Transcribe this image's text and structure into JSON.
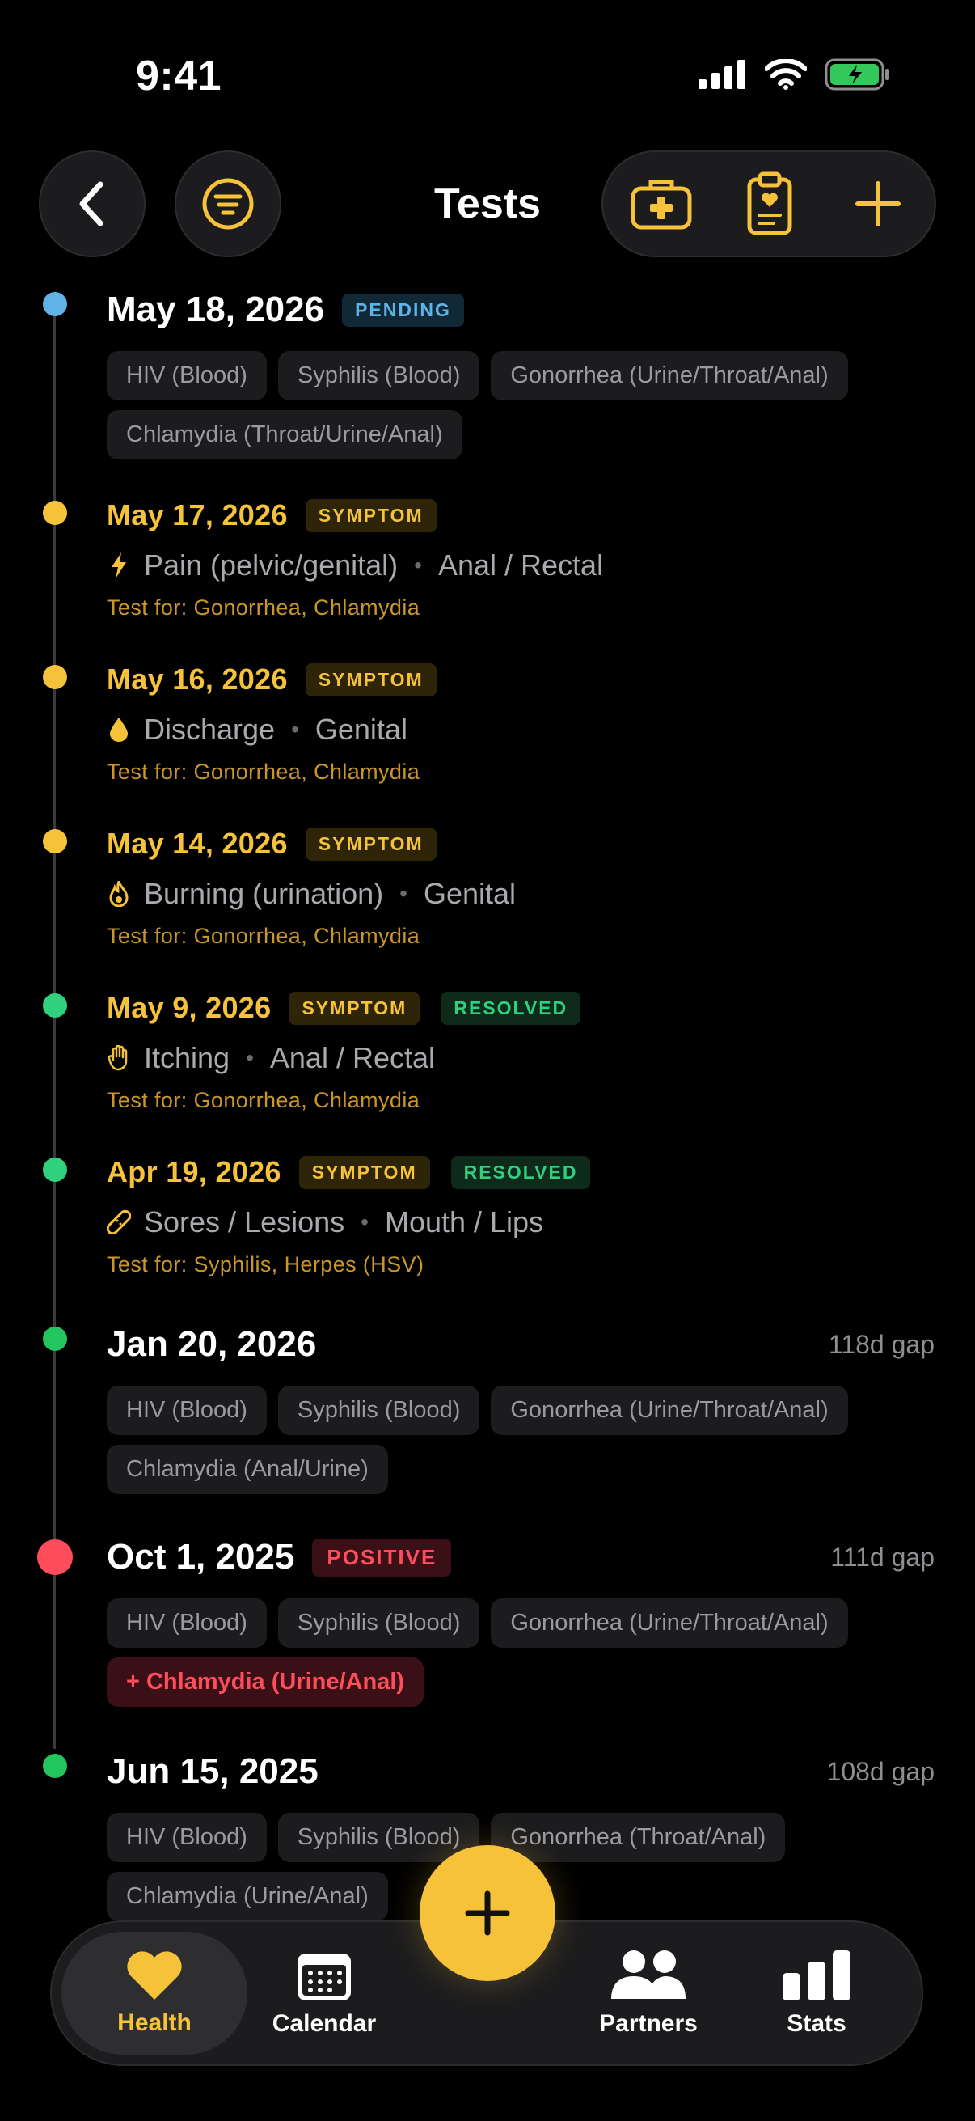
{
  "status": {
    "time": "9:41"
  },
  "header": {
    "title": "Tests"
  },
  "entries": [
    {
      "date": "May 18, 2026",
      "badge": "PENDING",
      "chips": [
        "HIV (Blood)",
        "Syphilis (Blood)",
        "Gonorrhea (Urine/Throat/Anal)",
        "Chlamydia (Throat/Urine/Anal)"
      ]
    },
    {
      "date": "May 17, 2026",
      "badge": "SYMPTOM",
      "symptom": "Pain (pelvic/genital)",
      "site": "Anal / Rectal",
      "test_for": "Test for: Gonorrhea, Chlamydia"
    },
    {
      "date": "May 16, 2026",
      "badge": "SYMPTOM",
      "symptom": "Discharge",
      "site": "Genital",
      "test_for": "Test for: Gonorrhea, Chlamydia"
    },
    {
      "date": "May 14, 2026",
      "badge": "SYMPTOM",
      "symptom": "Burning (urination)",
      "site": "Genital",
      "test_for": "Test for: Gonorrhea, Chlamydia"
    },
    {
      "date": "May 9, 2026",
      "badge": "SYMPTOM",
      "badge2": "RESOLVED",
      "symptom": "Itching",
      "site": "Anal / Rectal",
      "test_for": "Test for: Gonorrhea, Chlamydia"
    },
    {
      "date": "Apr 19, 2026",
      "badge": "SYMPTOM",
      "badge2": "RESOLVED",
      "symptom": "Sores / Lesions",
      "site": "Mouth / Lips",
      "test_for": "Test for: Syphilis, Herpes (HSV)"
    },
    {
      "date": "Jan 20, 2026",
      "gap": "118d gap",
      "chips": [
        "HIV (Blood)",
        "Syphilis (Blood)",
        "Gonorrhea (Urine/Throat/Anal)",
        "Chlamydia (Anal/Urine)"
      ]
    },
    {
      "date": "Oct 1, 2025",
      "badge": "POSITIVE",
      "gap": "111d gap",
      "chips": [
        "HIV (Blood)",
        "Syphilis (Blood)",
        "Gonorrhea (Urine/Throat/Anal)"
      ],
      "positive_chip": "+ Chlamydia (Urine/Anal)"
    },
    {
      "date": "Jun 15, 2025",
      "gap": "108d gap",
      "chips": [
        "HIV (Blood)",
        "Syphilis (Blood)",
        "Gonorrhea (Throat/Anal)",
        "Chlamydia (Urine/Anal)"
      ]
    }
  ],
  "nav": {
    "health": "Health",
    "calendar": "Calendar",
    "partners": "Partners",
    "stats": "Stats"
  },
  "colors": {
    "accent": "#f5c23a",
    "pending": "#5fb3e8",
    "resolved": "#2fd07e",
    "positive": "#ff4d5c",
    "negative": "#22c55e"
  },
  "icons": [
    "back-chevron-icon",
    "filter-icon",
    "first-aid-kit-icon",
    "clipboard-heart-icon",
    "plus-icon",
    "bolt-icon",
    "droplet-icon",
    "flame-icon",
    "hand-icon",
    "bandage-icon",
    "heart-icon",
    "calendar-icon",
    "people-icon",
    "bar-chart-icon"
  ]
}
